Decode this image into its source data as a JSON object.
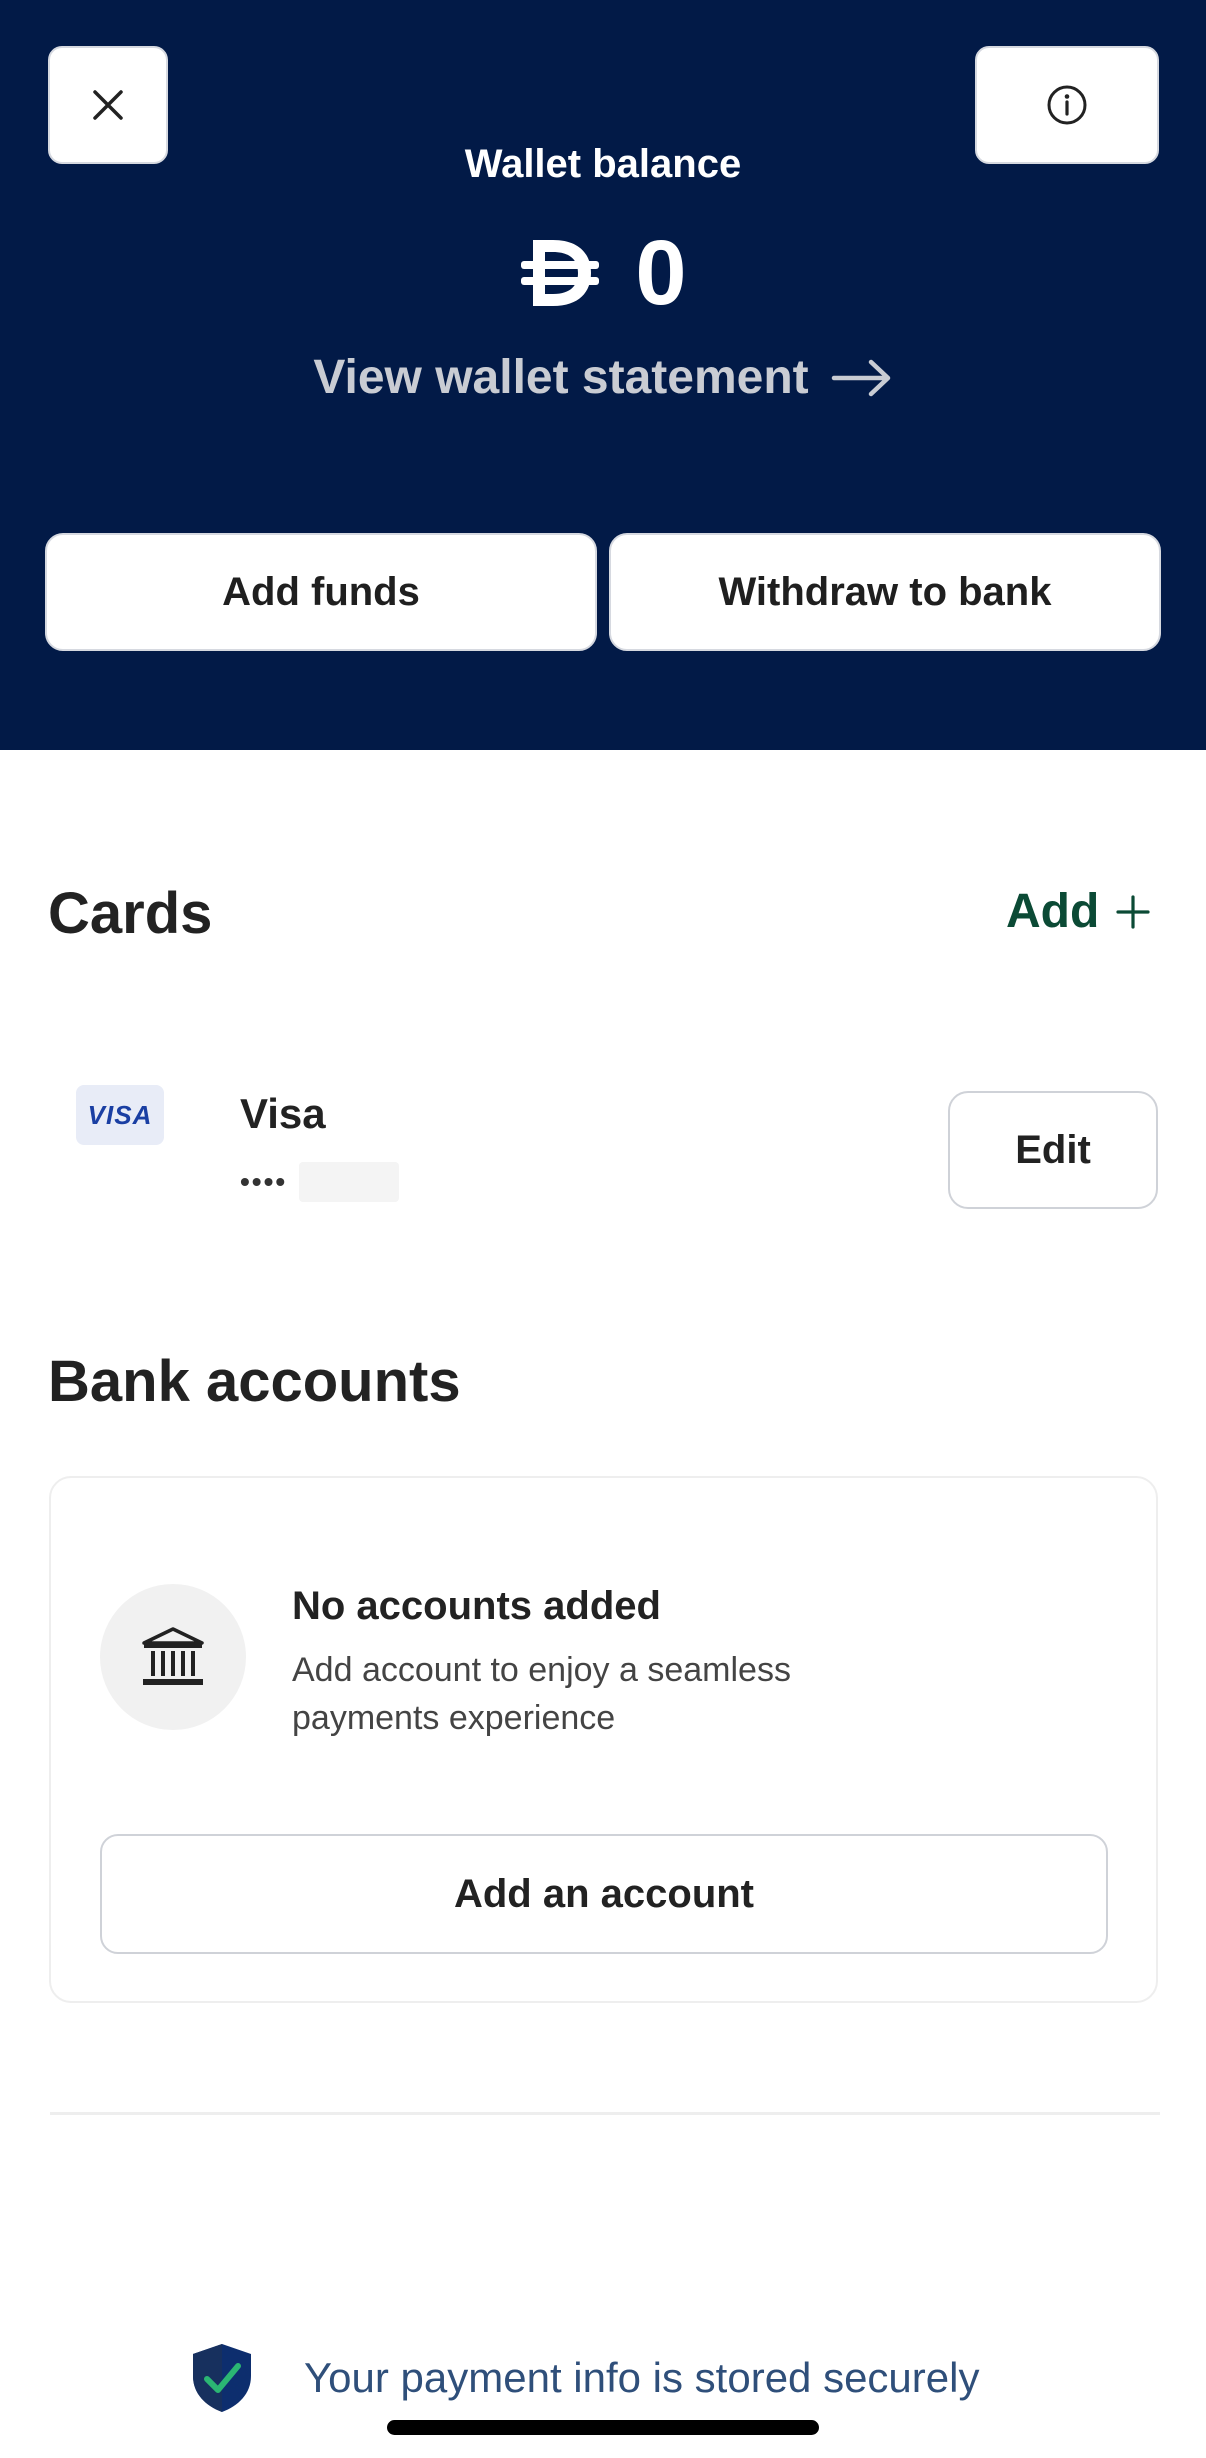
{
  "header": {
    "wallet_label": "Wallet balance",
    "currency_symbol": "dirham-icon",
    "balance": "0",
    "statement_link": "View wallet statement",
    "add_funds": "Add funds",
    "withdraw": "Withdraw to bank",
    "background": "#021a47"
  },
  "cards": {
    "title": "Cards",
    "add_label": "Add",
    "items": [
      {
        "brand_logo": "VISA",
        "name": "Visa",
        "masked": "••••",
        "edit_label": "Edit"
      }
    ]
  },
  "bank": {
    "title": "Bank accounts",
    "empty_title": "No accounts added",
    "empty_subtitle": "Add account to enjoy a seamless payments experience",
    "add_button": "Add an account"
  },
  "footer": {
    "secure_text": "Your payment info is stored securely"
  },
  "colors": {
    "accent": "#0b4a35",
    "shield": "#0d2e6e",
    "check": "#2bb673"
  }
}
